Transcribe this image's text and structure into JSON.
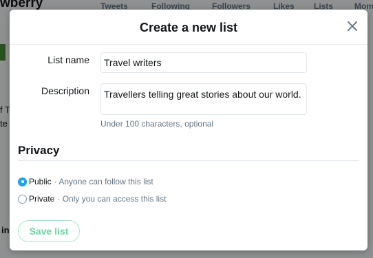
{
  "background": {
    "profile_name_partial": "wberry",
    "nav": [
      "Tweets",
      "Following",
      "Followers",
      "Likes",
      "Lists",
      "Mom"
    ],
    "left_fragments": [
      "f T",
      "te",
      "in"
    ]
  },
  "modal": {
    "title": "Create a new list",
    "close_icon": "close-icon",
    "list_name": {
      "label": "List name",
      "value": "Travel writers"
    },
    "description": {
      "label": "Description",
      "value": "Travellers telling great stories about our world.",
      "hint": "Under 100 characters, optional"
    },
    "privacy": {
      "title": "Privacy",
      "options": [
        {
          "label": "Public",
          "description": "· Anyone can follow this list",
          "selected": true
        },
        {
          "label": "Private",
          "description": "· Only you can access this list",
          "selected": false
        }
      ]
    },
    "save_label": "Save list"
  },
  "colors": {
    "accent": "#1da1f2",
    "save_button_text": "#6fd5a5",
    "save_button_border": "#a8e6c9",
    "secondary_text": "#657786"
  }
}
